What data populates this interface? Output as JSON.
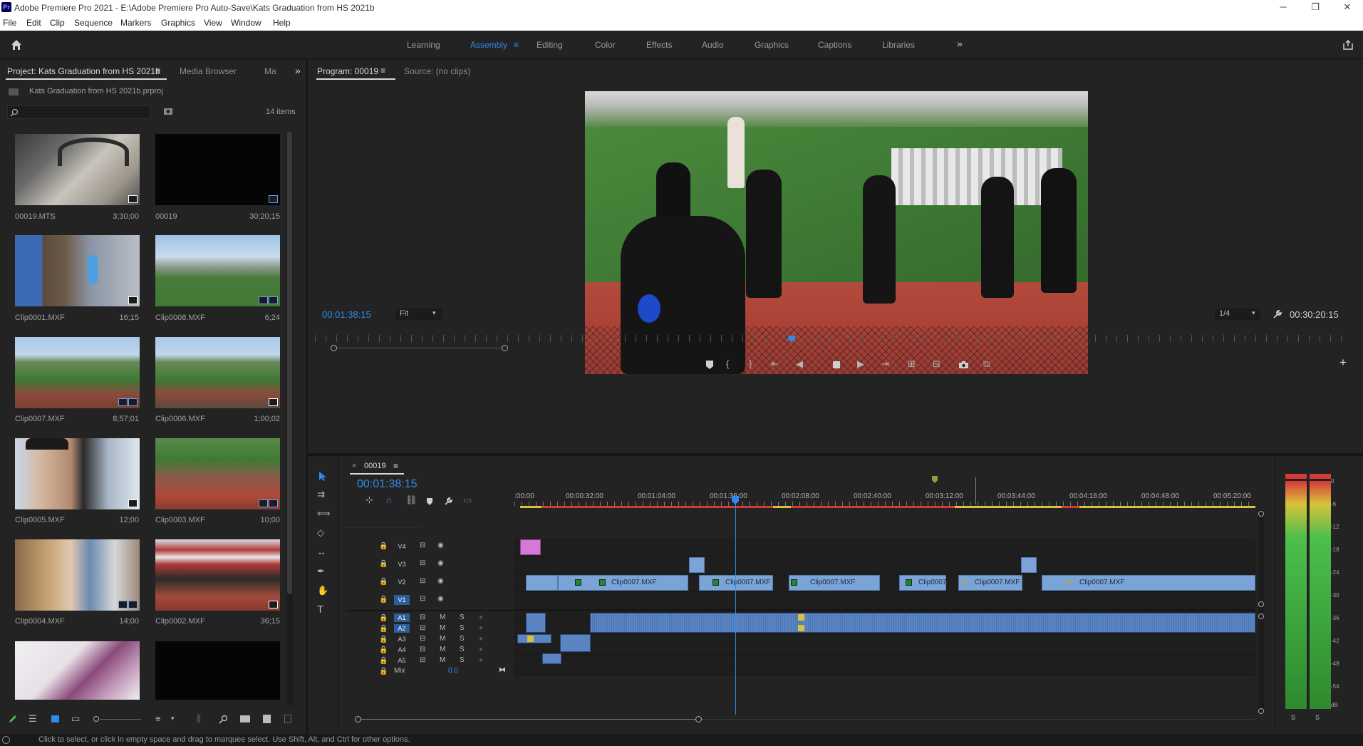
{
  "window": {
    "title": "Adobe Premiere Pro 2021 - E:\\Adobe Premiere Pro Auto-Save\\Kats Graduation from HS 2021b",
    "app_icon": "Pr"
  },
  "menu": [
    "File",
    "Edit",
    "Clip",
    "Sequence",
    "Markers",
    "Graphics",
    "View",
    "Window",
    "Help"
  ],
  "workspaces": {
    "items": [
      "Learning",
      "Assembly",
      "Editing",
      "Color",
      "Effects",
      "Audio",
      "Graphics",
      "Captions",
      "Libraries"
    ],
    "active": "Assembly",
    "overflow_glyph": "»"
  },
  "project_panel": {
    "tabs": [
      "Project: Kats Graduation from HS 2021b",
      "Media Browser",
      "Ma"
    ],
    "menu_glyph": "≡",
    "overflow_glyph": "»",
    "file": "Kats Graduation from HS 2021b.prproj",
    "search_placeholder": "",
    "item_count": "14 items",
    "items": [
      {
        "name": "00019.MTS",
        "duration": "3;30;00"
      },
      {
        "name": "00019",
        "duration": "30;20;15"
      },
      {
        "name": "Clip0001.MXF",
        "duration": "16;15"
      },
      {
        "name": "Clip0008.MXF",
        "duration": "6;24"
      },
      {
        "name": "Clip0007.MXF",
        "duration": "8;57;01"
      },
      {
        "name": "Clip0006.MXF",
        "duration": "1;00;02"
      },
      {
        "name": "Clip0005.MXF",
        "duration": "12;00"
      },
      {
        "name": "Clip0003.MXF",
        "duration": "10;00"
      },
      {
        "name": "Clip0004.MXF",
        "duration": "14;00"
      },
      {
        "name": "Clip0002.MXF",
        "duration": "36;15"
      }
    ]
  },
  "program_monitor": {
    "tabs": [
      "Program: 00019",
      "Source: (no clips)"
    ],
    "menu_glyph": "≡",
    "current_time": "00:01:38:15",
    "fit": "Fit",
    "resolution": "1/4",
    "duration": "00:30:20:15",
    "playhead_fraction": 0.46,
    "add_glyph": "+"
  },
  "timeline": {
    "sequence_name": "00019",
    "close_glyph": "×",
    "menu_glyph": "≡",
    "current_time": "00:01:38:15",
    "ruler_labels": [
      ":00:00",
      "00:00:32:00",
      "00:01:04:00",
      "00:01:36:00",
      "00:02:08:00",
      "00:02:40:00",
      "00:03:12:00",
      "00:03:44:00",
      "00:04:16:00",
      "00:04:48:00",
      "00:05:20:00"
    ],
    "video_tracks": [
      "V4",
      "V3",
      "V2",
      "V1"
    ],
    "audio_tracks": [
      "A1",
      "A2",
      "A3",
      "A4",
      "A5"
    ],
    "mute_label": "M",
    "solo_label": "S",
    "mix_label": "Mix",
    "mix_value": "0.0",
    "clip_names": [
      "Clip0007.MXF",
      "Clip0007.MXF",
      "Clip0007.MXF",
      "Clip0007.",
      "Clip0007.MXF",
      "Clip0007.MXF"
    ],
    "fx_label": "fx"
  },
  "audio_meter": {
    "scale": [
      "0",
      "-6",
      "-12",
      "-18",
      "-24",
      "-30",
      "-36",
      "-42",
      "-48",
      "-54",
      "dB"
    ],
    "solo_labels": [
      "S",
      "S"
    ]
  },
  "status_bar": {
    "text": "Click to select, or click in empty space and drag to marquee select. Use Shift, Alt, and Ctrl for other options."
  },
  "colors": {
    "accent": "#2d8ceb",
    "video_clip": "#7aa3d8",
    "audio_clip": "#5b84c2",
    "pink_clip": "#d977d8",
    "render_red": "#d63a3a",
    "render_yellow": "#d8c23a"
  }
}
